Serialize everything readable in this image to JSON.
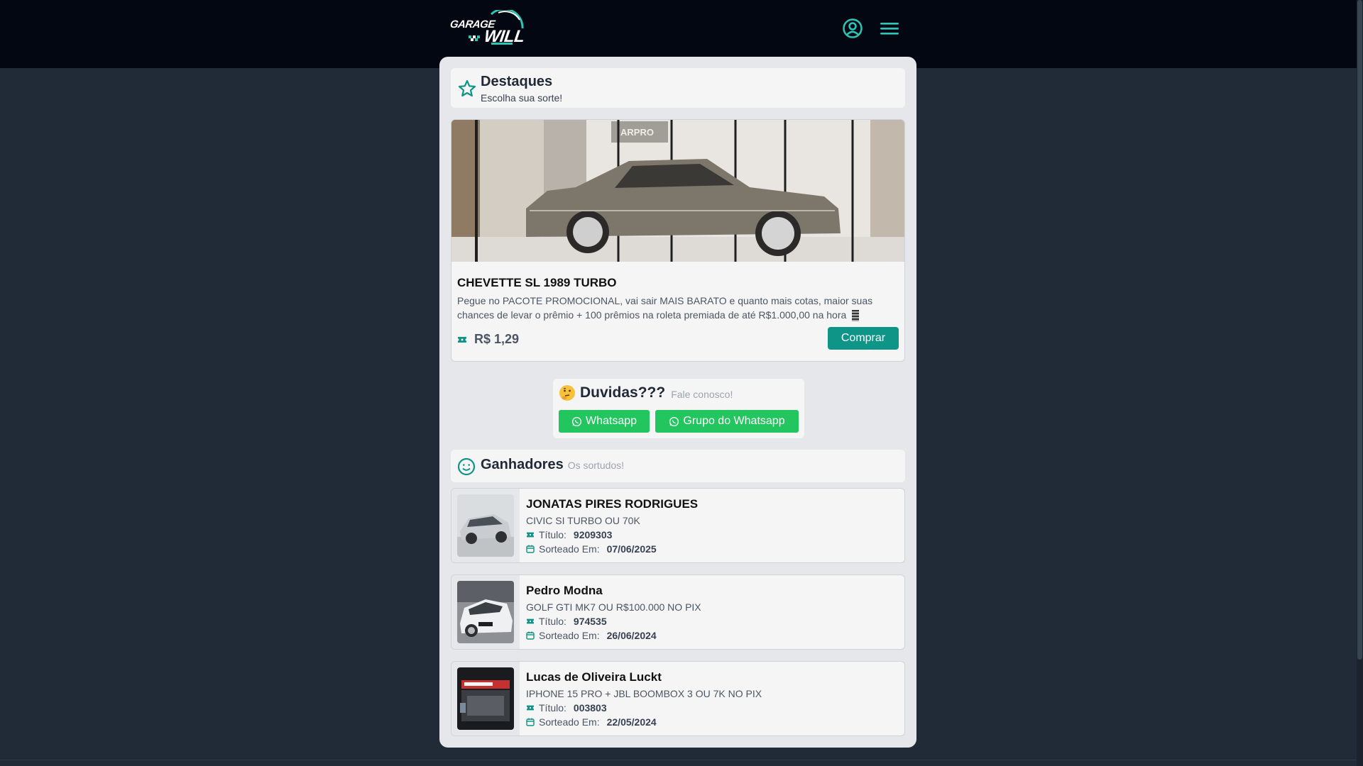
{
  "header": {
    "logo_line1": "GARAGE",
    "logo_line2": "WILL",
    "user_icon": "user-circle-icon",
    "menu_icon": "hamburger-menu-icon",
    "accent": "#2ec4b6"
  },
  "destaques": {
    "title": "Destaques",
    "subtitle": "Escolha sua sorte!",
    "icon": "star-icon"
  },
  "featured": {
    "image_watermark": "ARPRO",
    "title": "CHEVETTE SL 1989 TURBO",
    "description": "Pegue no PACOTE PROMOCIONAL, vai sair MAIS BARATO e quanto mais cotas, maior suas chances de levar o prêmio + 100 prêmios na roleta premiada de até R$1.000,00 na hora",
    "price": "R$ 1,29",
    "buy_label": "Comprar"
  },
  "duvidas": {
    "title": "Duvidas???",
    "subtitle": "Fale conosco!",
    "whatsapp_label": "Whatsapp",
    "group_label": "Grupo do Whatsapp"
  },
  "ganhadores": {
    "title": "Ganhadores",
    "subtitle": "Os sortudos!",
    "titulo_label": "Título:",
    "sorteado_label": "Sorteado Em:",
    "items": [
      {
        "name": "JONATAS PIRES RODRIGUES",
        "prize": "CIVIC SI TURBO OU 70K",
        "titulo": "9209303",
        "date": "07/06/2025"
      },
      {
        "name": "Pedro Modna",
        "prize": "GOLF GTI MK7 OU R$100.000 NO PIX",
        "titulo": "974535",
        "date": "26/06/2024"
      },
      {
        "name": "Lucas de Oliveira Luckt",
        "prize": "IPHONE 15 PRO + JBL BOOMBOX 3 OU 7K NO PIX",
        "titulo": "003803",
        "date": "22/05/2024"
      }
    ]
  },
  "colors": {
    "teal": "#0f9488",
    "whatsapp": "#22c55e",
    "topbar": "#030712",
    "background": "#212b38"
  }
}
